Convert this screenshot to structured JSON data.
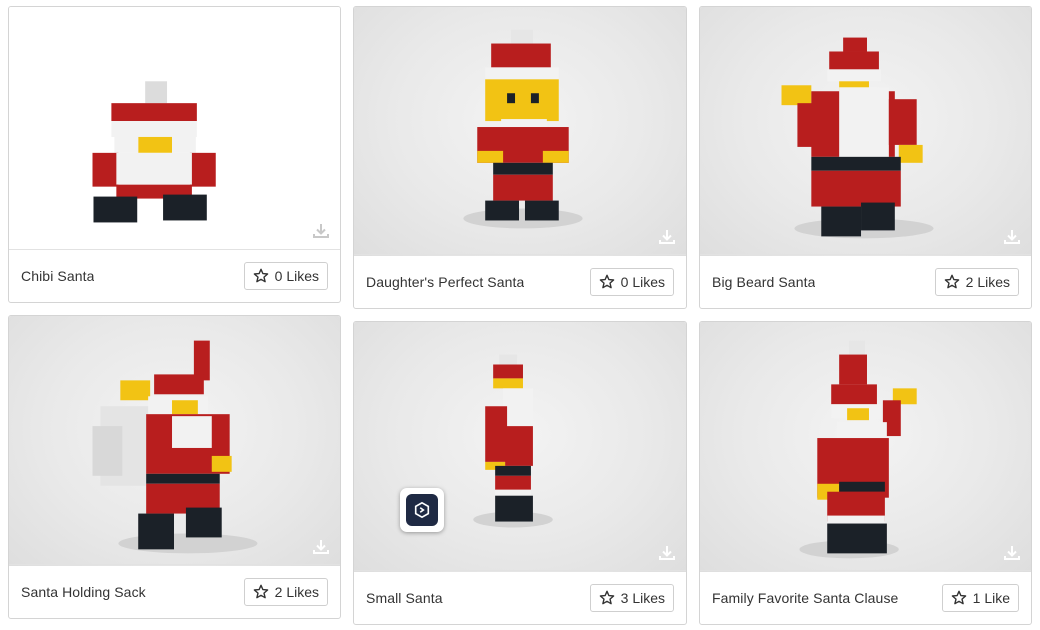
{
  "cards": [
    {
      "title": "Chibi Santa",
      "likes": "0 Likes",
      "image": "chibi-santa-model"
    },
    {
      "title": "Daughter's Perfect Santa",
      "likes": "0 Likes",
      "image": "daughters-perfect-santa-model"
    },
    {
      "title": "Big Beard Santa",
      "likes": "2 Likes",
      "image": "big-beard-santa-model"
    },
    {
      "title": "Santa Holding Sack",
      "likes": "2 Likes",
      "image": "santa-holding-sack-model"
    },
    {
      "title": "Small Santa",
      "likes": "3 Likes",
      "image": "small-santa-model"
    },
    {
      "title": "Family Favorite Santa Clause",
      "likes": "1 Like",
      "image": "family-favorite-santa-model"
    }
  ],
  "icons": {
    "like": "star-outline-icon",
    "download": "download-icon",
    "app_badge": "app-badge-icon"
  },
  "colors": {
    "brick_red": "#b81e1e",
    "brick_white": "#f2f2f2",
    "brick_yellow": "#f2c314",
    "brick_black": "#1b2128",
    "border": "#d4d4d4"
  }
}
